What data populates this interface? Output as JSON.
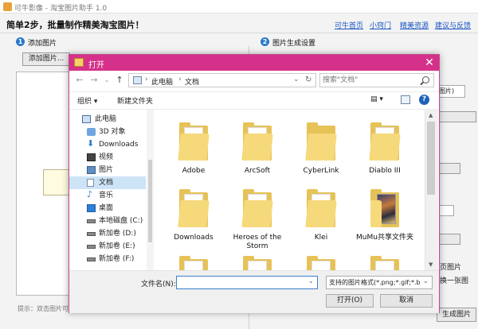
{
  "app": {
    "title": "可牛影像 - 淘宝图片助手 1.0",
    "headline": "简单2步，批量制作精美淘宝图片！",
    "links": [
      "可牛首页",
      "小窍门",
      "精美资源",
      "建议与反馈"
    ],
    "step1": {
      "num": "1",
      "label": "添加图片",
      "button": "添加图片..."
    },
    "step2": {
      "num": "2",
      "label": "图片生成设置"
    },
    "hint": "提示：双击图片可",
    "right": {
      "select_value": "图片)",
      "text1": "页图片",
      "text2": "换一张图",
      "generate": "生成图片"
    }
  },
  "dialog": {
    "title": "打开",
    "close": "✕",
    "address": {
      "part1": "此电脑",
      "part2": "文档",
      "sep": "›"
    },
    "search_placeholder": "搜索\"文档\"",
    "toolbar": {
      "organize": "组织 ▾",
      "new_folder": "新建文件夹",
      "view": "▤ ▾",
      "help": "?"
    },
    "nav": [
      {
        "label": "此电脑",
        "icon": "computer-icon"
      },
      {
        "label": "3D 对象",
        "icon": "3d-objects-icon"
      },
      {
        "label": "Downloads",
        "icon": "download-icon"
      },
      {
        "label": "视频",
        "icon": "video-icon"
      },
      {
        "label": "图片",
        "icon": "pictures-icon"
      },
      {
        "label": "文档",
        "icon": "documents-icon"
      },
      {
        "label": "音乐",
        "icon": "music-icon"
      },
      {
        "label": "桌面",
        "icon": "desktop-icon"
      },
      {
        "label": "本地磁盘 (C:)",
        "icon": "drive-icon"
      },
      {
        "label": "新加卷 (D:)",
        "icon": "drive-icon"
      },
      {
        "label": "新加卷 (E:)",
        "icon": "drive-icon"
      },
      {
        "label": "新加卷 (F:)",
        "icon": "drive-icon"
      }
    ],
    "files": [
      {
        "label": "Adobe",
        "kind": "folder"
      },
      {
        "label": "ArcSoft",
        "kind": "folder"
      },
      {
        "label": "CyberLink",
        "kind": "folder"
      },
      {
        "label": "Diablo III",
        "kind": "folder"
      },
      {
        "label": "Downloads",
        "kind": "folder"
      },
      {
        "label": "Heroes of the Storm",
        "kind": "folder"
      },
      {
        "label": "Klei",
        "kind": "folder"
      },
      {
        "label": "MuMu共享文件夹",
        "kind": "picture-folder"
      },
      {
        "label": "",
        "kind": "folder"
      },
      {
        "label": "",
        "kind": "folder"
      },
      {
        "label": "",
        "kind": "folder"
      },
      {
        "label": "",
        "kind": "folder"
      }
    ],
    "filename_label": "文件名(N):",
    "filename_value": "",
    "filetype": "支持的图片格式(*.png;*.gif;*.b",
    "open_button": "打开(O)",
    "cancel_button": "取消"
  }
}
